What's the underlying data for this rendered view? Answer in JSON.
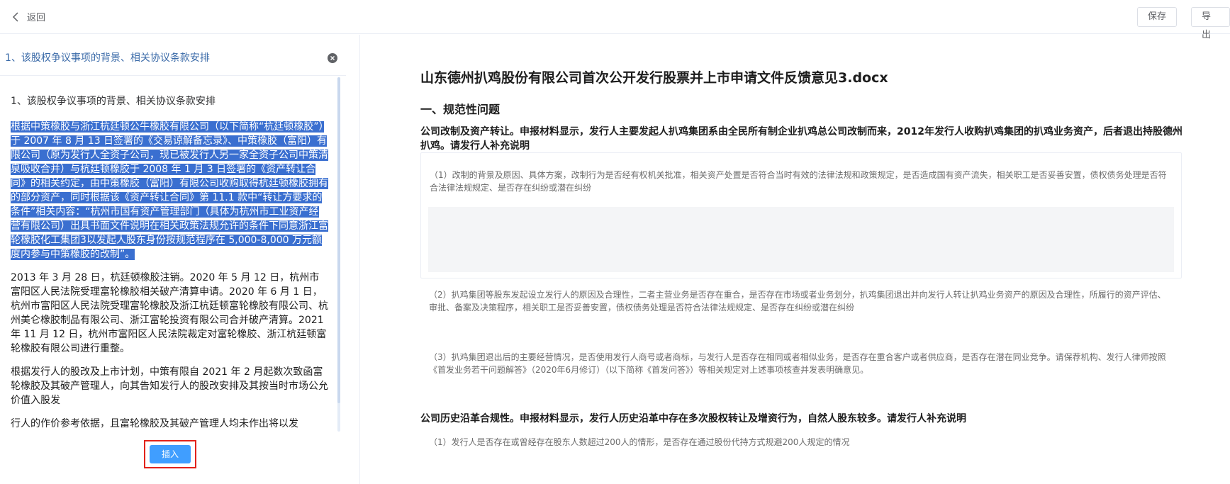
{
  "header": {
    "back_label": "返回",
    "save_label": "保存",
    "export_label": "导出"
  },
  "left": {
    "title": "1、该股权争议事项的背景、相关协议条款安排",
    "heading": "1、该股权争议事项的背景、相关协议条款安排",
    "highlighted": "根据中策橡胶与浙江杭廷顿公牛橡胶有限公司（以下简称“杭廷顿橡胶”）于 2007 年 8 月 13 日签署的《交易谅解备忘录》、中策橡胶（富阳）有限公司（原为发行人全资子公司，现已被发行人另一家全资子公司中策清泉吸收合并）与杭廷顿橡胶于 2008 年 1 月 3 日签署的《资产转让合同》的相关约定，由中策橡胶（富阳）有限公司收购取得杭廷顿橡胶拥有的部分资产，同时根据该《资产转让合同》第 11.1 款中“转让方要求的条件”相关内容：“杭州市国有资产管理部门（具体为杭州市工业资产经营有限公司）出具书面文件说明在相关政策法规允许的条件下同意浙江富轮橡胶化工集团3以发起人股东身份按规范程序在 5,000-8,000 万元额度内参与中策橡胶的改制”。",
    "para2": "2013 年 3 月 28 日，杭廷顿橡胶注销。2020 年 5 月 12 日，杭州市富阳区人民法院受理富轮橡胶相关破产清算申请。2020 年 6 月 1 日，杭州市富阳区人民法院受理富轮橡胶及浙江杭廷顿富轮橡胶有限公司、杭州美仑橡胶制品有限公司、浙江富轮投资有限公司合并破产清算。2021 年 11 月 12 日，杭州市富阳区人民法院裁定对富轮橡胶、浙江杭廷顿富轮橡胶有限公司进行重整。",
    "para3": "根据发行人的股改及上市计划，中策有限自 2021 年 2 月起数次致函富轮橡胶及其破产管理人，向其告知发行人的股改安排及其按当时市场公允价值入股发",
    "para4": "行人的作价参考依据，且富轮橡胶及其破产管理人均未作出将以发",
    "insert_label": "插入"
  },
  "doc": {
    "title": "山东德州扒鸡股份有限公司首次公开发行股票并上市申请文件反馈意见3.docx",
    "section1": "一、规范性问题",
    "q1_title": "公司改制及资产转让。申报材料显示，发行人主要发起人扒鸡集团系由全民所有制企业扒鸡总公司改制而来，2012年发行人收购扒鸡集团的扒鸡业务资产，后者退出持股德州扒鸡。请发行人补充说明",
    "q1_sub": "（1）改制的背景及原因、具体方案，改制行为是否经有权机关批准，相关资产处置是否符合当时有效的法律法规和政策规定，是否造成国有资产流失，相关职工是否妥善安置，债权债务处理是否符合法律法规规定、是否存在纠纷或潜在纠纷",
    "q2": "（2）扒鸡集团等股东发起设立发行人的原因及合理性，二者主营业务是否存在重合，是否存在市场或者业务划分，扒鸡集团退出并向发行人转让扒鸡业务资产的原因及合理性，所履行的资产评估、审批、备案及决策程序，相关职工是否妥善安置，债权债务处理是否符合法律法规规定、是否存在纠纷或潜在纠纷",
    "q3": "（3）扒鸡集团退出后的主要经营情况，是否使用发行人商号或者商标，与发行人是否存在相同或者相似业务，是否存在重合客户或者供应商，是否存在潜在同业竞争。请保荐机构、发行人律师按照《首发业务若干问题解答》（2020年6月修订）（以下简称《首发问答》）等相关规定对上述事项核查并发表明确意见。",
    "section2": "公司历史沿革合规性。申报材料显示，发行人历史沿革中存在多次股权转让及增资行为，自然人股东较多。请发行人补充说明",
    "q4": "（1）发行人是否存在或曾经存在股东人数超过200人的情形，是否存在通过股份代持方式规避200人规定的情况"
  }
}
